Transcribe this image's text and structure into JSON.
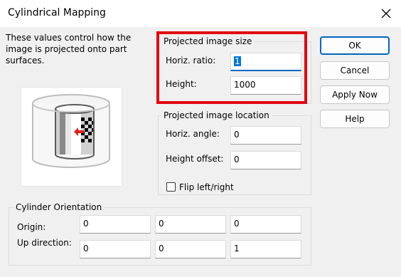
{
  "window": {
    "title": "Cylindrical Mapping"
  },
  "description": "These values control how the image is projected onto part surfaces.",
  "projected_size": {
    "legend": "Projected image size",
    "horiz_ratio_label": "Horiz. ratio:",
    "horiz_ratio_value": "1",
    "height_label": "Height:",
    "height_value": "1000"
  },
  "projected_location": {
    "legend": "Projected image location",
    "horiz_angle_label": "Horiz. angle:",
    "horiz_angle_value": "0",
    "height_offset_label": "Height offset:",
    "height_offset_value": "0",
    "flip_label": "Flip left/right",
    "flip_checked": false
  },
  "cylinder_orientation": {
    "legend": "Cylinder Orientation",
    "origin_label": "Origin:",
    "origin_values": [
      "0",
      "0",
      "0"
    ],
    "up_label": "Up direction:",
    "up_values": [
      "0",
      "0",
      "1"
    ]
  },
  "buttons": {
    "ok": "OK",
    "cancel": "Cancel",
    "apply_now": "Apply Now",
    "help": "Help"
  },
  "colors": {
    "highlight": "#e30613",
    "accent": "#0067c0"
  }
}
